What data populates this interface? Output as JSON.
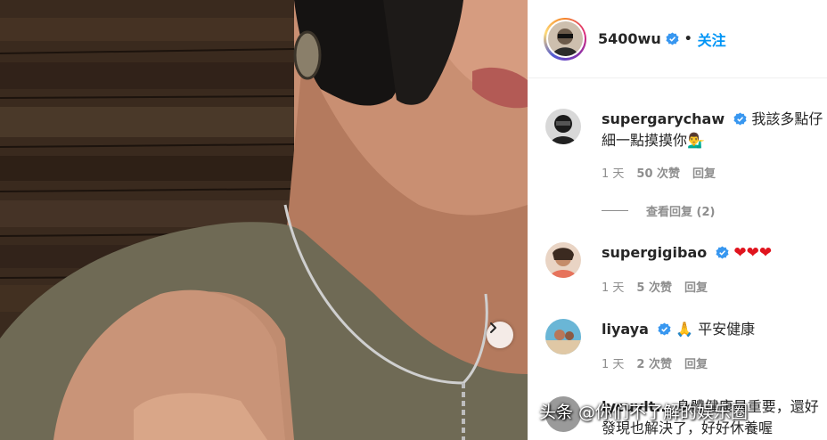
{
  "post": {
    "author": "5400wu",
    "dot": "•",
    "follow_label": "关注"
  },
  "comments": [
    {
      "user": "supergarychaw",
      "text": "我該多點仔細一點摸摸你",
      "emoji": "💁‍♂️",
      "time": "1 天",
      "likes": "50 次赞",
      "reply": "回复",
      "view_replies": "查看回复 (2)"
    },
    {
      "user": "supergigibao",
      "text": "",
      "emoji": "❤❤❤",
      "time": "1 天",
      "likes": "5 次赞",
      "reply": "回复"
    },
    {
      "user": "liyaya",
      "text": "平安健康",
      "emoji": "🙏",
      "time": "1 天",
      "likes": "2 次赞",
      "reply": "回复"
    },
    {
      "user": "lycuvlt...",
      "text": "身體健康最重要，還好發現也解決了，好好休養喔"
    }
  ],
  "watermark": "头条 @你们不了解的娱乐圈",
  "colors": {
    "accent": "#0095f6",
    "verified": "#3897f0",
    "muted": "#8e8e8e"
  },
  "icons": [
    "verified-badge-icon",
    "chevron-right-icon",
    "red-heart-icon",
    "praying-hands-icon"
  ]
}
